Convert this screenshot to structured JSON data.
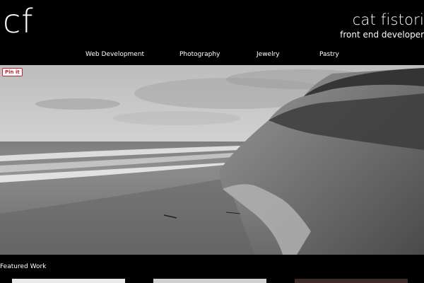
{
  "header": {
    "logo_text": "cf",
    "name": "cat fistori",
    "tagline": "front end developer"
  },
  "nav": {
    "items": [
      "Web Development",
      "Photography",
      "Jewelry",
      "Pastry"
    ]
  },
  "hero": {
    "pin_label": "Pin it",
    "pin_color": "#c8232c"
  },
  "featured": {
    "title": "Featured Work"
  }
}
